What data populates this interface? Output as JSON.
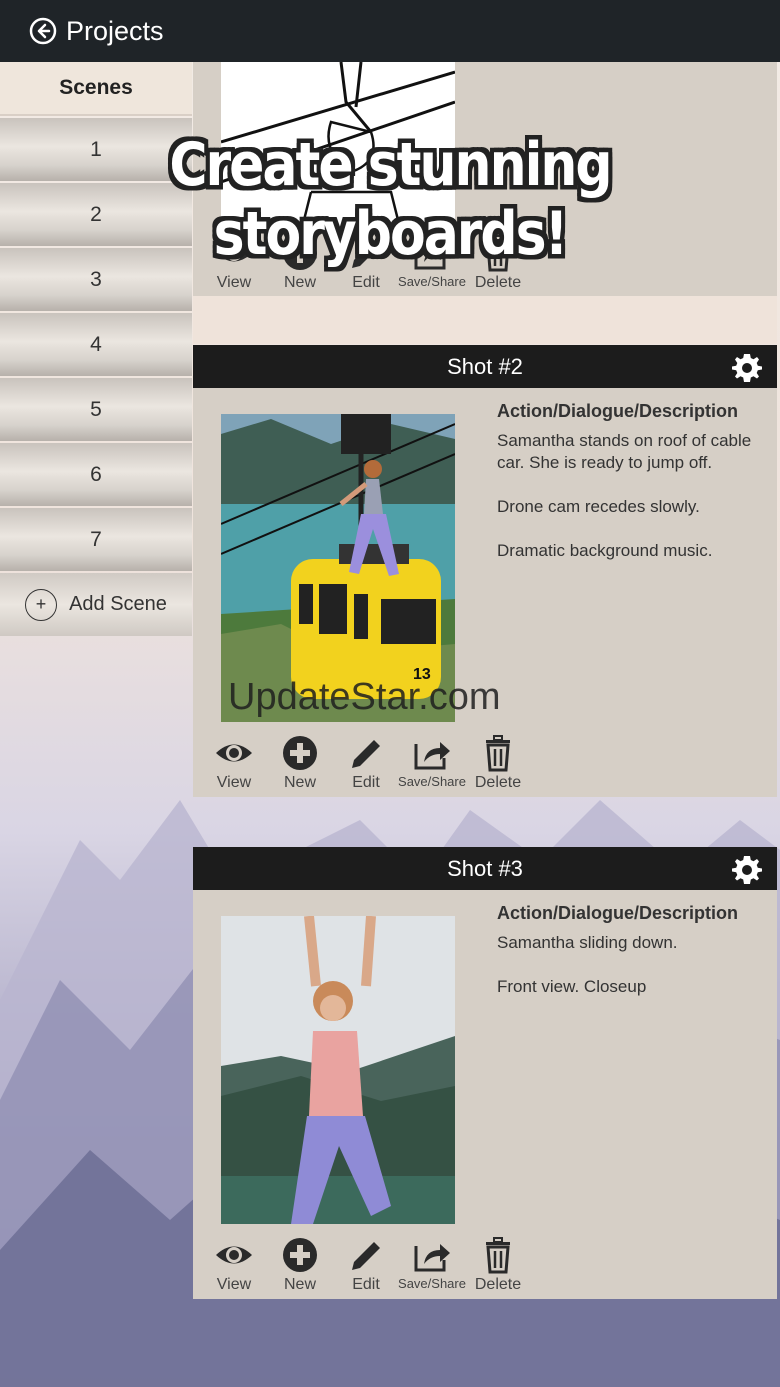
{
  "topbar": {
    "back_label": "Projects"
  },
  "banner": {
    "text": "Create stunning storyboards!"
  },
  "watermark": {
    "text": "UpdateStar.com"
  },
  "sidebar": {
    "header": "Scenes",
    "items": [
      {
        "label": "1"
      },
      {
        "label": "2"
      },
      {
        "label": "3"
      },
      {
        "label": "4"
      },
      {
        "label": "5"
      },
      {
        "label": "6"
      },
      {
        "label": "7"
      }
    ],
    "add_label": "Add Scene"
  },
  "toolbar": {
    "view": "View",
    "new": "New",
    "edit": "Edit",
    "save_share": "Save/Share",
    "delete": "Delete"
  },
  "shots": [
    {
      "title": "Shot #2",
      "desc_heading": "Action/Dialogue/Description",
      "paragraphs": [
        "Samantha stands on roof of cable car. She is ready to jump off.",
        "Drone cam recedes slowly.",
        "Dramatic background music."
      ],
      "image_text": "13"
    },
    {
      "title": "Shot #3",
      "desc_heading": "Action/Dialogue/Description",
      "paragraphs": [
        "Samantha sliding down.",
        "Front view. Closeup"
      ]
    }
  ],
  "colors": {
    "topbar": "#1f2428",
    "panel": "#d6cfc6",
    "shot_header": "#1c1c1c",
    "cable_car": "#f2d21e"
  }
}
